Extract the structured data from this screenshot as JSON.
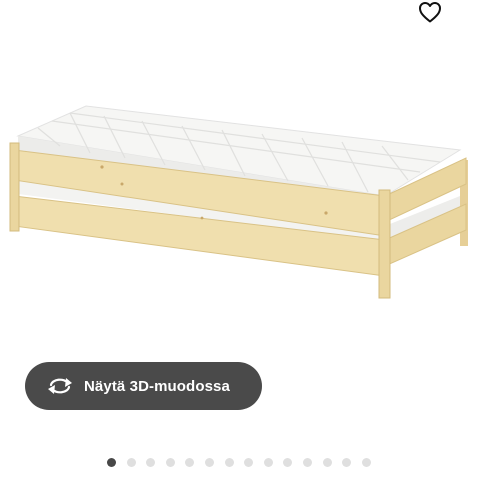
{
  "favorite": {
    "icon": "heart-outline-icon"
  },
  "product": {
    "image": "stackable-bed-with-mattresses"
  },
  "view3d": {
    "label": "Näytä 3D-muodossa",
    "icon": "rotate-arrows-icon"
  },
  "pagination": {
    "total": 14,
    "active_index": 0
  },
  "colors": {
    "button_bg": "#4a4a4a",
    "dot_active": "#484848",
    "dot_inactive": "#dfdfdf",
    "wood": "#eedcaa"
  }
}
